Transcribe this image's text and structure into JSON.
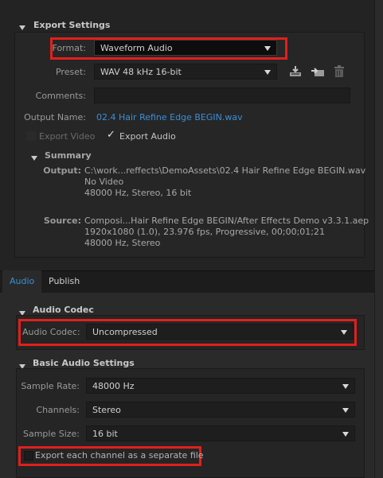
{
  "export_settings": {
    "title": "Export Settings",
    "format_label": "Format:",
    "format_value": "Waveform Audio",
    "preset_label": "Preset:",
    "preset_value": "WAV 48 kHz 16-bit",
    "comments_label": "Comments:",
    "comments_value": "",
    "output_name_label": "Output Name:",
    "output_name_value": "02.4 Hair Refine Edge BEGIN.wav",
    "export_video_label": "Export Video",
    "export_audio_label": "Export Audio",
    "export_video_checked": false,
    "export_audio_checked": true
  },
  "summary": {
    "title": "Summary",
    "output_label": "Output:",
    "output_lines": [
      "C:\\work...reffects\\DemoAssets\\02.4 Hair Refine Edge BEGIN.wav",
      "No Video",
      "48000 Hz, Stereo, 16 bit"
    ],
    "source_label": "Source:",
    "source_lines": [
      "Composi...Hair Refine Edge BEGIN/After Effects Demo v3.3.1.aep",
      "1920x1080 (1.0), 23.976 fps, Progressive, 00;00;01;21",
      "48000 Hz, Stereo"
    ]
  },
  "tabs": [
    {
      "label": "Audio",
      "active": true
    },
    {
      "label": "Publish",
      "active": false
    }
  ],
  "audio_codec": {
    "title": "Audio Codec",
    "label": "Audio Codec:",
    "value": "Uncompressed"
  },
  "basic_audio": {
    "title": "Basic Audio Settings",
    "sample_rate_label": "Sample Rate:",
    "sample_rate_value": "48000 Hz",
    "channels_label": "Channels:",
    "channels_value": "Stereo",
    "sample_size_label": "Sample Size:",
    "sample_size_value": "16 bit",
    "separate_channel_label": "Export each channel as a separate file",
    "separate_channel_checked": false
  },
  "colors": {
    "highlight": "#e0201c",
    "link": "#3a8fd8",
    "active_tab": "#3a8fd8"
  }
}
